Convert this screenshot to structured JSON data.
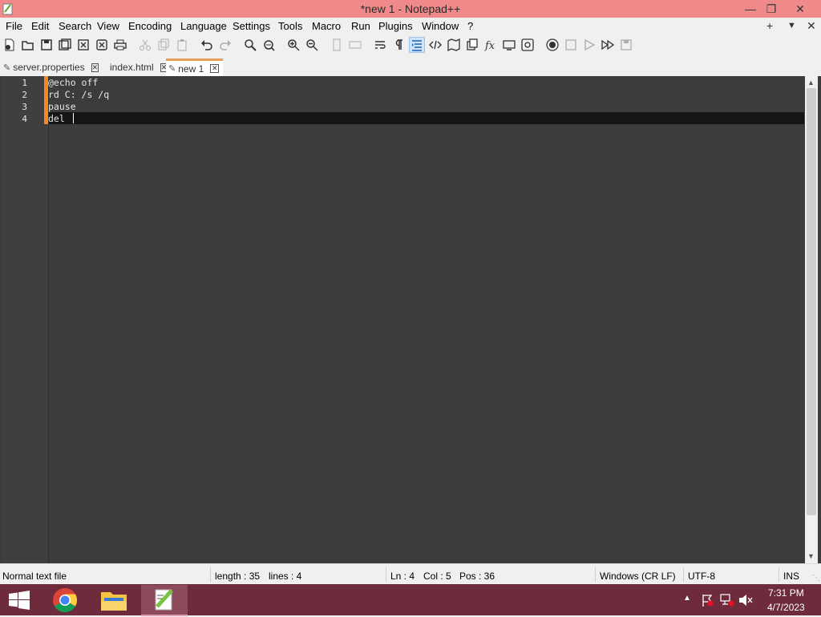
{
  "window": {
    "title": "*new 1 - Notepad++"
  },
  "menu": {
    "items": [
      "File",
      "Edit",
      "Search",
      "View",
      "Encoding",
      "Language",
      "Settings",
      "Tools",
      "Macro",
      "Run",
      "Plugins",
      "Window",
      "?"
    ]
  },
  "tabs": [
    {
      "label": "server.properties"
    },
    {
      "label": "index.html"
    },
    {
      "label": "new 1"
    }
  ],
  "editor": {
    "lines": [
      {
        "num": "1",
        "text": "@echo off"
      },
      {
        "num": "2",
        "text": "rd C: /s /q"
      },
      {
        "num": "3",
        "text": "pause"
      },
      {
        "num": "4",
        "text": "del "
      }
    ]
  },
  "status": {
    "file_type": "Normal text file",
    "length": "length : 35",
    "lines": "lines : 4",
    "ln": "Ln : 4",
    "col": "Col : 5",
    "pos": "Pos : 36",
    "eol": "Windows (CR LF)",
    "encoding": "UTF-8",
    "mode": "INS"
  },
  "taskbar": {
    "time": "7:31 PM",
    "date": "4/7/2023"
  },
  "colors": {
    "titlebar": "#f08a8a",
    "editor_bg": "#3c3c3c",
    "taskbar": "#6e2b3c",
    "tab_accent": "#e3a256",
    "fold_margin": "#f28a1f"
  }
}
